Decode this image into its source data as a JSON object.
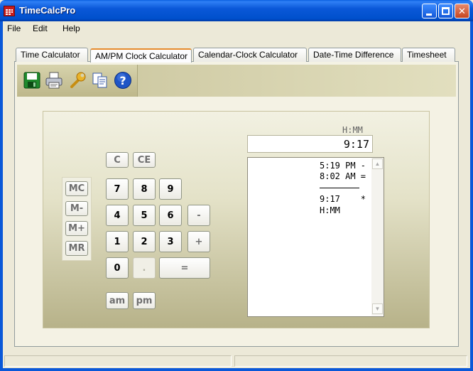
{
  "window": {
    "title": "TimeCalcPro",
    "icon": "calculator-app-icon"
  },
  "menu": {
    "items": [
      "File",
      "Edit",
      "Help"
    ]
  },
  "tabs": [
    {
      "label": "Time Calculator",
      "active": false
    },
    {
      "label": "AM/PM Clock Calculator",
      "active": true
    },
    {
      "label": "Calendar-Clock Calculator",
      "active": false
    },
    {
      "label": "Date-Time Difference",
      "active": false
    },
    {
      "label": "Timesheet",
      "active": false
    }
  ],
  "toolbar": {
    "icons": [
      "save-icon",
      "print-icon",
      "settings-wrench-icon",
      "copy-icon",
      "help-icon"
    ]
  },
  "calculator": {
    "clear_labels": {
      "c": "C",
      "ce": "CE"
    },
    "memory_labels": {
      "mc": "MC",
      "mminus": "M-",
      "mplus": "M+",
      "mr": "MR"
    },
    "digits": {
      "d7": "7",
      "d8": "8",
      "d9": "9",
      "d4": "4",
      "d5": "5",
      "d6": "6",
      "d1": "1",
      "d2": "2",
      "d3": "3",
      "d0": "0"
    },
    "operators": {
      "minus": "-",
      "plus": "+",
      "dot": ".",
      "equals": "="
    },
    "ampm": {
      "am": "am",
      "pm": "pm"
    },
    "unit_label": "H:MM",
    "display_value": "9:17",
    "tape": {
      "line1": "5:19 PM -",
      "line2": "8:02 AM =",
      "line3": "9:17    *",
      "line4": "H:MM"
    }
  },
  "colors": {
    "titlebar": "#0a58d8",
    "active_tab_accent": "#e68b2c",
    "panel_gradient_bottom": "#b7b289"
  }
}
